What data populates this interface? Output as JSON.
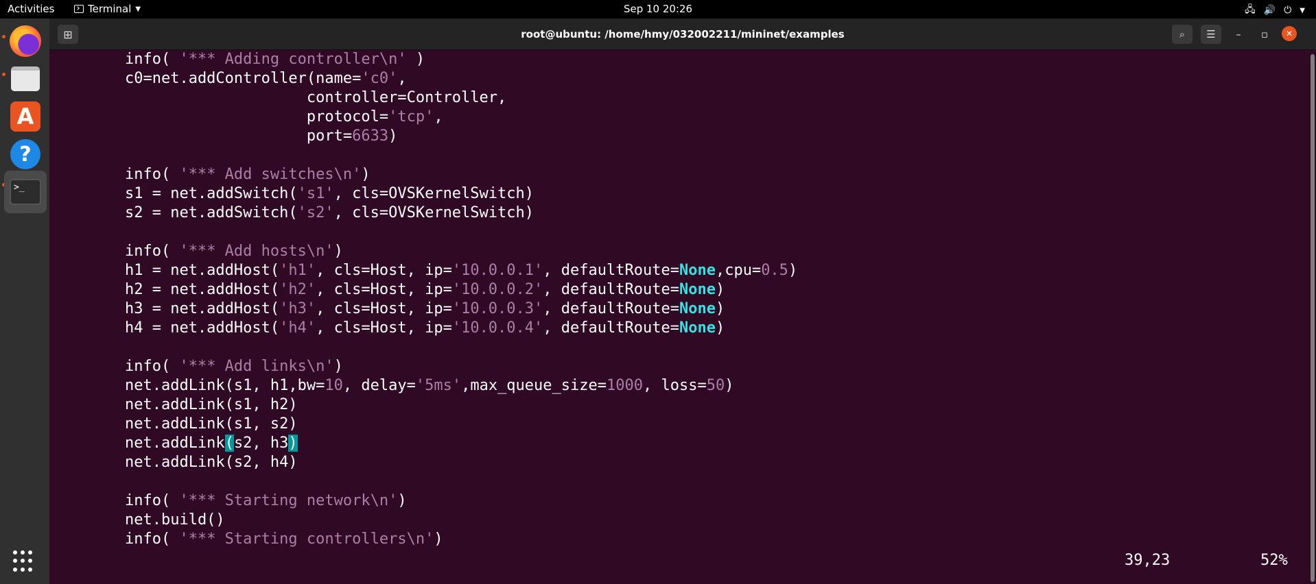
{
  "topbar": {
    "activities": "Activities",
    "app_name": "Terminal",
    "clock": "Sep 10  20:26"
  },
  "window": {
    "title": "root@ubuntu: /home/hmy/032002211/mininet/examples"
  },
  "dock": {
    "items": [
      "firefox",
      "files",
      "ubuntu-software",
      "help",
      "terminal"
    ]
  },
  "editor": {
    "lines": [
      [
        {
          "t": "    info( "
        },
        {
          "t": "'*** Adding controller\\n'",
          "c": "str"
        },
        {
          "t": " )"
        }
      ],
      [
        {
          "t": "    c0=net.addController(name="
        },
        {
          "t": "'c0'",
          "c": "str"
        },
        {
          "t": ","
        }
      ],
      [
        {
          "t": "                        controller=Controller,"
        }
      ],
      [
        {
          "t": "                        protocol="
        },
        {
          "t": "'tcp'",
          "c": "str"
        },
        {
          "t": ","
        }
      ],
      [
        {
          "t": "                        port="
        },
        {
          "t": "6633",
          "c": "str"
        },
        {
          "t": ")"
        }
      ],
      [],
      [
        {
          "t": "    info( "
        },
        {
          "t": "'*** Add switches\\n'",
          "c": "str"
        },
        {
          "t": ")"
        }
      ],
      [
        {
          "t": "    s1 = net.addSwitch("
        },
        {
          "t": "'s1'",
          "c": "str"
        },
        {
          "t": ", cls=OVSKernelSwitch)"
        }
      ],
      [
        {
          "t": "    s2 = net.addSwitch("
        },
        {
          "t": "'s2'",
          "c": "str"
        },
        {
          "t": ", cls=OVSKernelSwitch)"
        }
      ],
      [],
      [
        {
          "t": "    info( "
        },
        {
          "t": "'*** Add hosts\\n'",
          "c": "str"
        },
        {
          "t": ")"
        }
      ],
      [
        {
          "t": "    h1 = net.addHost("
        },
        {
          "t": "'h1'",
          "c": "str"
        },
        {
          "t": ", cls=Host, ip="
        },
        {
          "t": "'10.0.0.1'",
          "c": "str"
        },
        {
          "t": ", defaultRoute="
        },
        {
          "t": "None",
          "c": "kw"
        },
        {
          "t": ",cpu="
        },
        {
          "t": "0.5",
          "c": "str"
        },
        {
          "t": ")"
        }
      ],
      [
        {
          "t": "    h2 = net.addHost("
        },
        {
          "t": "'h2'",
          "c": "str"
        },
        {
          "t": ", cls=Host, ip="
        },
        {
          "t": "'10.0.0.2'",
          "c": "str"
        },
        {
          "t": ", defaultRoute="
        },
        {
          "t": "None",
          "c": "kw"
        },
        {
          "t": ")"
        }
      ],
      [
        {
          "t": "    h3 = net.addHost("
        },
        {
          "t": "'h3'",
          "c": "str"
        },
        {
          "t": ", cls=Host, ip="
        },
        {
          "t": "'10.0.0.3'",
          "c": "str"
        },
        {
          "t": ", defaultRoute="
        },
        {
          "t": "None",
          "c": "kw"
        },
        {
          "t": ")"
        }
      ],
      [
        {
          "t": "    h4 = net.addHost("
        },
        {
          "t": "'h4'",
          "c": "str"
        },
        {
          "t": ", cls=Host, ip="
        },
        {
          "t": "'10.0.0.4'",
          "c": "str"
        },
        {
          "t": ", defaultRoute="
        },
        {
          "t": "None",
          "c": "kw"
        },
        {
          "t": ")"
        }
      ],
      [],
      [
        {
          "t": "    info( "
        },
        {
          "t": "'*** Add links\\n'",
          "c": "str"
        },
        {
          "t": ")"
        }
      ],
      [
        {
          "t": "    net.addLink(s1, h1,bw="
        },
        {
          "t": "10",
          "c": "str"
        },
        {
          "t": ", delay="
        },
        {
          "t": "'5ms'",
          "c": "str"
        },
        {
          "t": ",max_queue_size="
        },
        {
          "t": "1000",
          "c": "str"
        },
        {
          "t": ", loss="
        },
        {
          "t": "50",
          "c": "str"
        },
        {
          "t": ")"
        }
      ],
      [
        {
          "t": "    net.addLink(s1, h2)"
        }
      ],
      [
        {
          "t": "    net.addLink(s1, s2)"
        }
      ],
      [
        {
          "t": "    net.addLink"
        },
        {
          "t": "(",
          "c": "hl"
        },
        {
          "t": "s2, h3"
        },
        {
          "t": ")",
          "c": "hl"
        }
      ],
      [
        {
          "t": "    net.addLink(s2, h4)"
        }
      ],
      [],
      [
        {
          "t": "    info( "
        },
        {
          "t": "'*** Starting network\\n'",
          "c": "str"
        },
        {
          "t": ")"
        }
      ],
      [
        {
          "t": "    net.build()"
        }
      ],
      [
        {
          "t": "    info( "
        },
        {
          "t": "'*** Starting controllers\\n'",
          "c": "str"
        },
        {
          "t": ")"
        }
      ]
    ],
    "cursor_position": "39,23",
    "scroll_percent": "52%"
  }
}
